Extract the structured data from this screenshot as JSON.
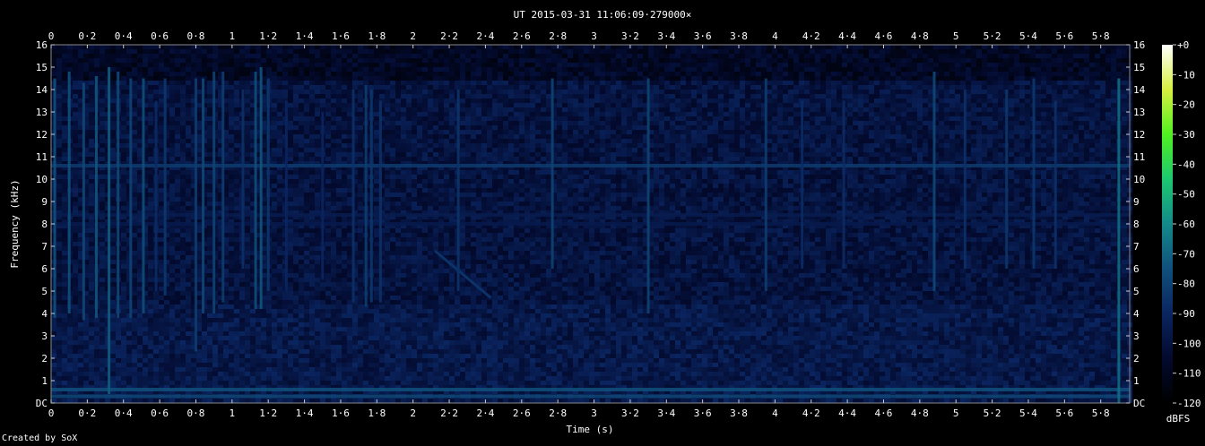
{
  "chart_data": {
    "type": "heatmap",
    "title": "UT 2015-03-31 11:06:09·279000×",
    "xlabel": "Time (s)",
    "ylabel": "Frequency (kHz)",
    "xlim": [
      0,
      5.96
    ],
    "ylim": [
      0,
      16
    ],
    "x_ticks": [
      "0",
      "0·2",
      "0·4",
      "0·6",
      "0·8",
      "1",
      "1·2",
      "1·4",
      "1·6",
      "1·8",
      "2",
      "2·2",
      "2·4",
      "2·6",
      "2·8",
      "3",
      "3·2",
      "3·4",
      "3·6",
      "3·8",
      "4",
      "4·2",
      "4·4",
      "4·6",
      "4·8",
      "5",
      "5·2",
      "5·4",
      "5·6",
      "5·8"
    ],
    "x_tick_values": [
      0,
      0.2,
      0.4,
      0.6,
      0.8,
      1,
      1.2,
      1.4,
      1.6,
      1.8,
      2,
      2.2,
      2.4,
      2.6,
      2.8,
      3,
      3.2,
      3.4,
      3.6,
      3.8,
      4,
      4.2,
      4.4,
      4.6,
      4.8,
      5,
      5.2,
      5.4,
      5.6,
      5.8
    ],
    "y_ticks": [
      "DC",
      "1",
      "2",
      "3",
      "4",
      "5",
      "6",
      "7",
      "8",
      "9",
      "10",
      "11",
      "12",
      "13",
      "14",
      "15",
      "16"
    ],
    "colorbar": {
      "label": "dBFS",
      "ticks": [
        "+0",
        "-10",
        "-20",
        "-30",
        "-40",
        "-50",
        "-60",
        "-70",
        "-80",
        "-90",
        "-100",
        "-110",
        "-120"
      ],
      "range": [
        -120,
        0
      ]
    },
    "colormap": [
      "#000000",
      "#030a2e",
      "#0a2560",
      "#10507c",
      "#148a8a",
      "#1cc870",
      "#50f020",
      "#d8f040",
      "#ffffff"
    ],
    "background_level_dbfs": -100,
    "horizontal_bands": [
      {
        "freq_khz": 10.6,
        "level_dbfs": -82
      },
      {
        "freq_khz": 8.4,
        "level_dbfs": -95
      },
      {
        "freq_khz": 8.0,
        "level_dbfs": -96
      },
      {
        "freq_khz": 0.6,
        "level_dbfs": -75
      },
      {
        "freq_khz": 0.3,
        "level_dbfs": -78
      }
    ],
    "clicks": [
      {
        "t": 0.02,
        "top_khz": 14.5,
        "bottom_khz": 3.8,
        "level_dbfs": -75
      },
      {
        "t": 0.1,
        "top_khz": 14.8,
        "bottom_khz": 4.0,
        "level_dbfs": -75
      },
      {
        "t": 0.18,
        "top_khz": 14.3,
        "bottom_khz": 3.7,
        "level_dbfs": -78
      },
      {
        "t": 0.25,
        "top_khz": 14.6,
        "bottom_khz": 3.8,
        "level_dbfs": -74
      },
      {
        "t": 0.32,
        "top_khz": 15.0,
        "bottom_khz": 0.4,
        "level_dbfs": -72
      },
      {
        "t": 0.37,
        "top_khz": 14.8,
        "bottom_khz": 3.8,
        "level_dbfs": -78
      },
      {
        "t": 0.44,
        "top_khz": 14.5,
        "bottom_khz": 3.8,
        "level_dbfs": -80
      },
      {
        "t": 0.51,
        "top_khz": 14.5,
        "bottom_khz": 4.0,
        "level_dbfs": -76
      },
      {
        "t": 0.58,
        "top_khz": 13.5,
        "bottom_khz": 5.0,
        "level_dbfs": -88
      },
      {
        "t": 0.63,
        "top_khz": 14.5,
        "bottom_khz": 4.8,
        "level_dbfs": -84
      },
      {
        "t": 0.8,
        "top_khz": 14.5,
        "bottom_khz": 2.3,
        "level_dbfs": -82
      },
      {
        "t": 0.84,
        "top_khz": 14.5,
        "bottom_khz": 4.0,
        "level_dbfs": -78
      },
      {
        "t": 0.9,
        "top_khz": 14.8,
        "bottom_khz": 4.0,
        "level_dbfs": -80
      },
      {
        "t": 0.95,
        "top_khz": 14.8,
        "bottom_khz": 4.5,
        "level_dbfs": -82
      },
      {
        "t": 1.06,
        "top_khz": 14.0,
        "bottom_khz": 6.0,
        "level_dbfs": -86
      },
      {
        "t": 1.13,
        "top_khz": 14.8,
        "bottom_khz": 4.2,
        "level_dbfs": -76
      },
      {
        "t": 1.16,
        "top_khz": 15.0,
        "bottom_khz": 4.2,
        "level_dbfs": -74
      },
      {
        "t": 1.2,
        "top_khz": 14.5,
        "bottom_khz": 5.0,
        "level_dbfs": -84
      },
      {
        "t": 1.3,
        "top_khz": 13.5,
        "bottom_khz": 5.0,
        "level_dbfs": -90
      },
      {
        "t": 1.5,
        "top_khz": 13.0,
        "bottom_khz": 5.5,
        "level_dbfs": -90
      },
      {
        "t": 1.67,
        "top_khz": 14.0,
        "bottom_khz": 4.5,
        "level_dbfs": -86
      },
      {
        "t": 1.74,
        "top_khz": 14.2,
        "bottom_khz": 4.3,
        "level_dbfs": -82
      },
      {
        "t": 1.77,
        "top_khz": 14.0,
        "bottom_khz": 4.5,
        "level_dbfs": -84
      },
      {
        "t": 1.82,
        "top_khz": 13.5,
        "bottom_khz": 4.5,
        "level_dbfs": -86
      },
      {
        "t": 2.25,
        "top_khz": 14.0,
        "bottom_khz": 5.0,
        "level_dbfs": -85
      },
      {
        "t": 2.77,
        "top_khz": 14.5,
        "bottom_khz": 6.0,
        "level_dbfs": -80
      },
      {
        "t": 3.3,
        "top_khz": 14.5,
        "bottom_khz": 4.0,
        "level_dbfs": -80
      },
      {
        "t": 3.95,
        "top_khz": 14.5,
        "bottom_khz": 5.0,
        "level_dbfs": -82
      },
      {
        "t": 4.15,
        "top_khz": 13.5,
        "bottom_khz": 6.0,
        "level_dbfs": -88
      },
      {
        "t": 4.38,
        "top_khz": 13.5,
        "bottom_khz": 6.0,
        "level_dbfs": -88
      },
      {
        "t": 4.88,
        "top_khz": 14.8,
        "bottom_khz": 5.0,
        "level_dbfs": -78
      },
      {
        "t": 5.05,
        "top_khz": 14.0,
        "bottom_khz": 6.0,
        "level_dbfs": -86
      },
      {
        "t": 5.28,
        "top_khz": 14.0,
        "bottom_khz": 6.0,
        "level_dbfs": -84
      },
      {
        "t": 5.43,
        "top_khz": 14.5,
        "bottom_khz": 6.0,
        "level_dbfs": -84
      },
      {
        "t": 5.55,
        "top_khz": 13.5,
        "bottom_khz": 6.0,
        "level_dbfs": -86
      },
      {
        "t": 5.9,
        "top_khz": 14.5,
        "bottom_khz": 0.0,
        "level_dbfs": -68
      }
    ],
    "chirp": {
      "t_start": 2.12,
      "f_start_khz": 6.8,
      "t_end": 2.43,
      "f_end_khz": 4.7,
      "level_dbfs": -85
    }
  },
  "footer": {
    "credit": "Created by SoX"
  }
}
